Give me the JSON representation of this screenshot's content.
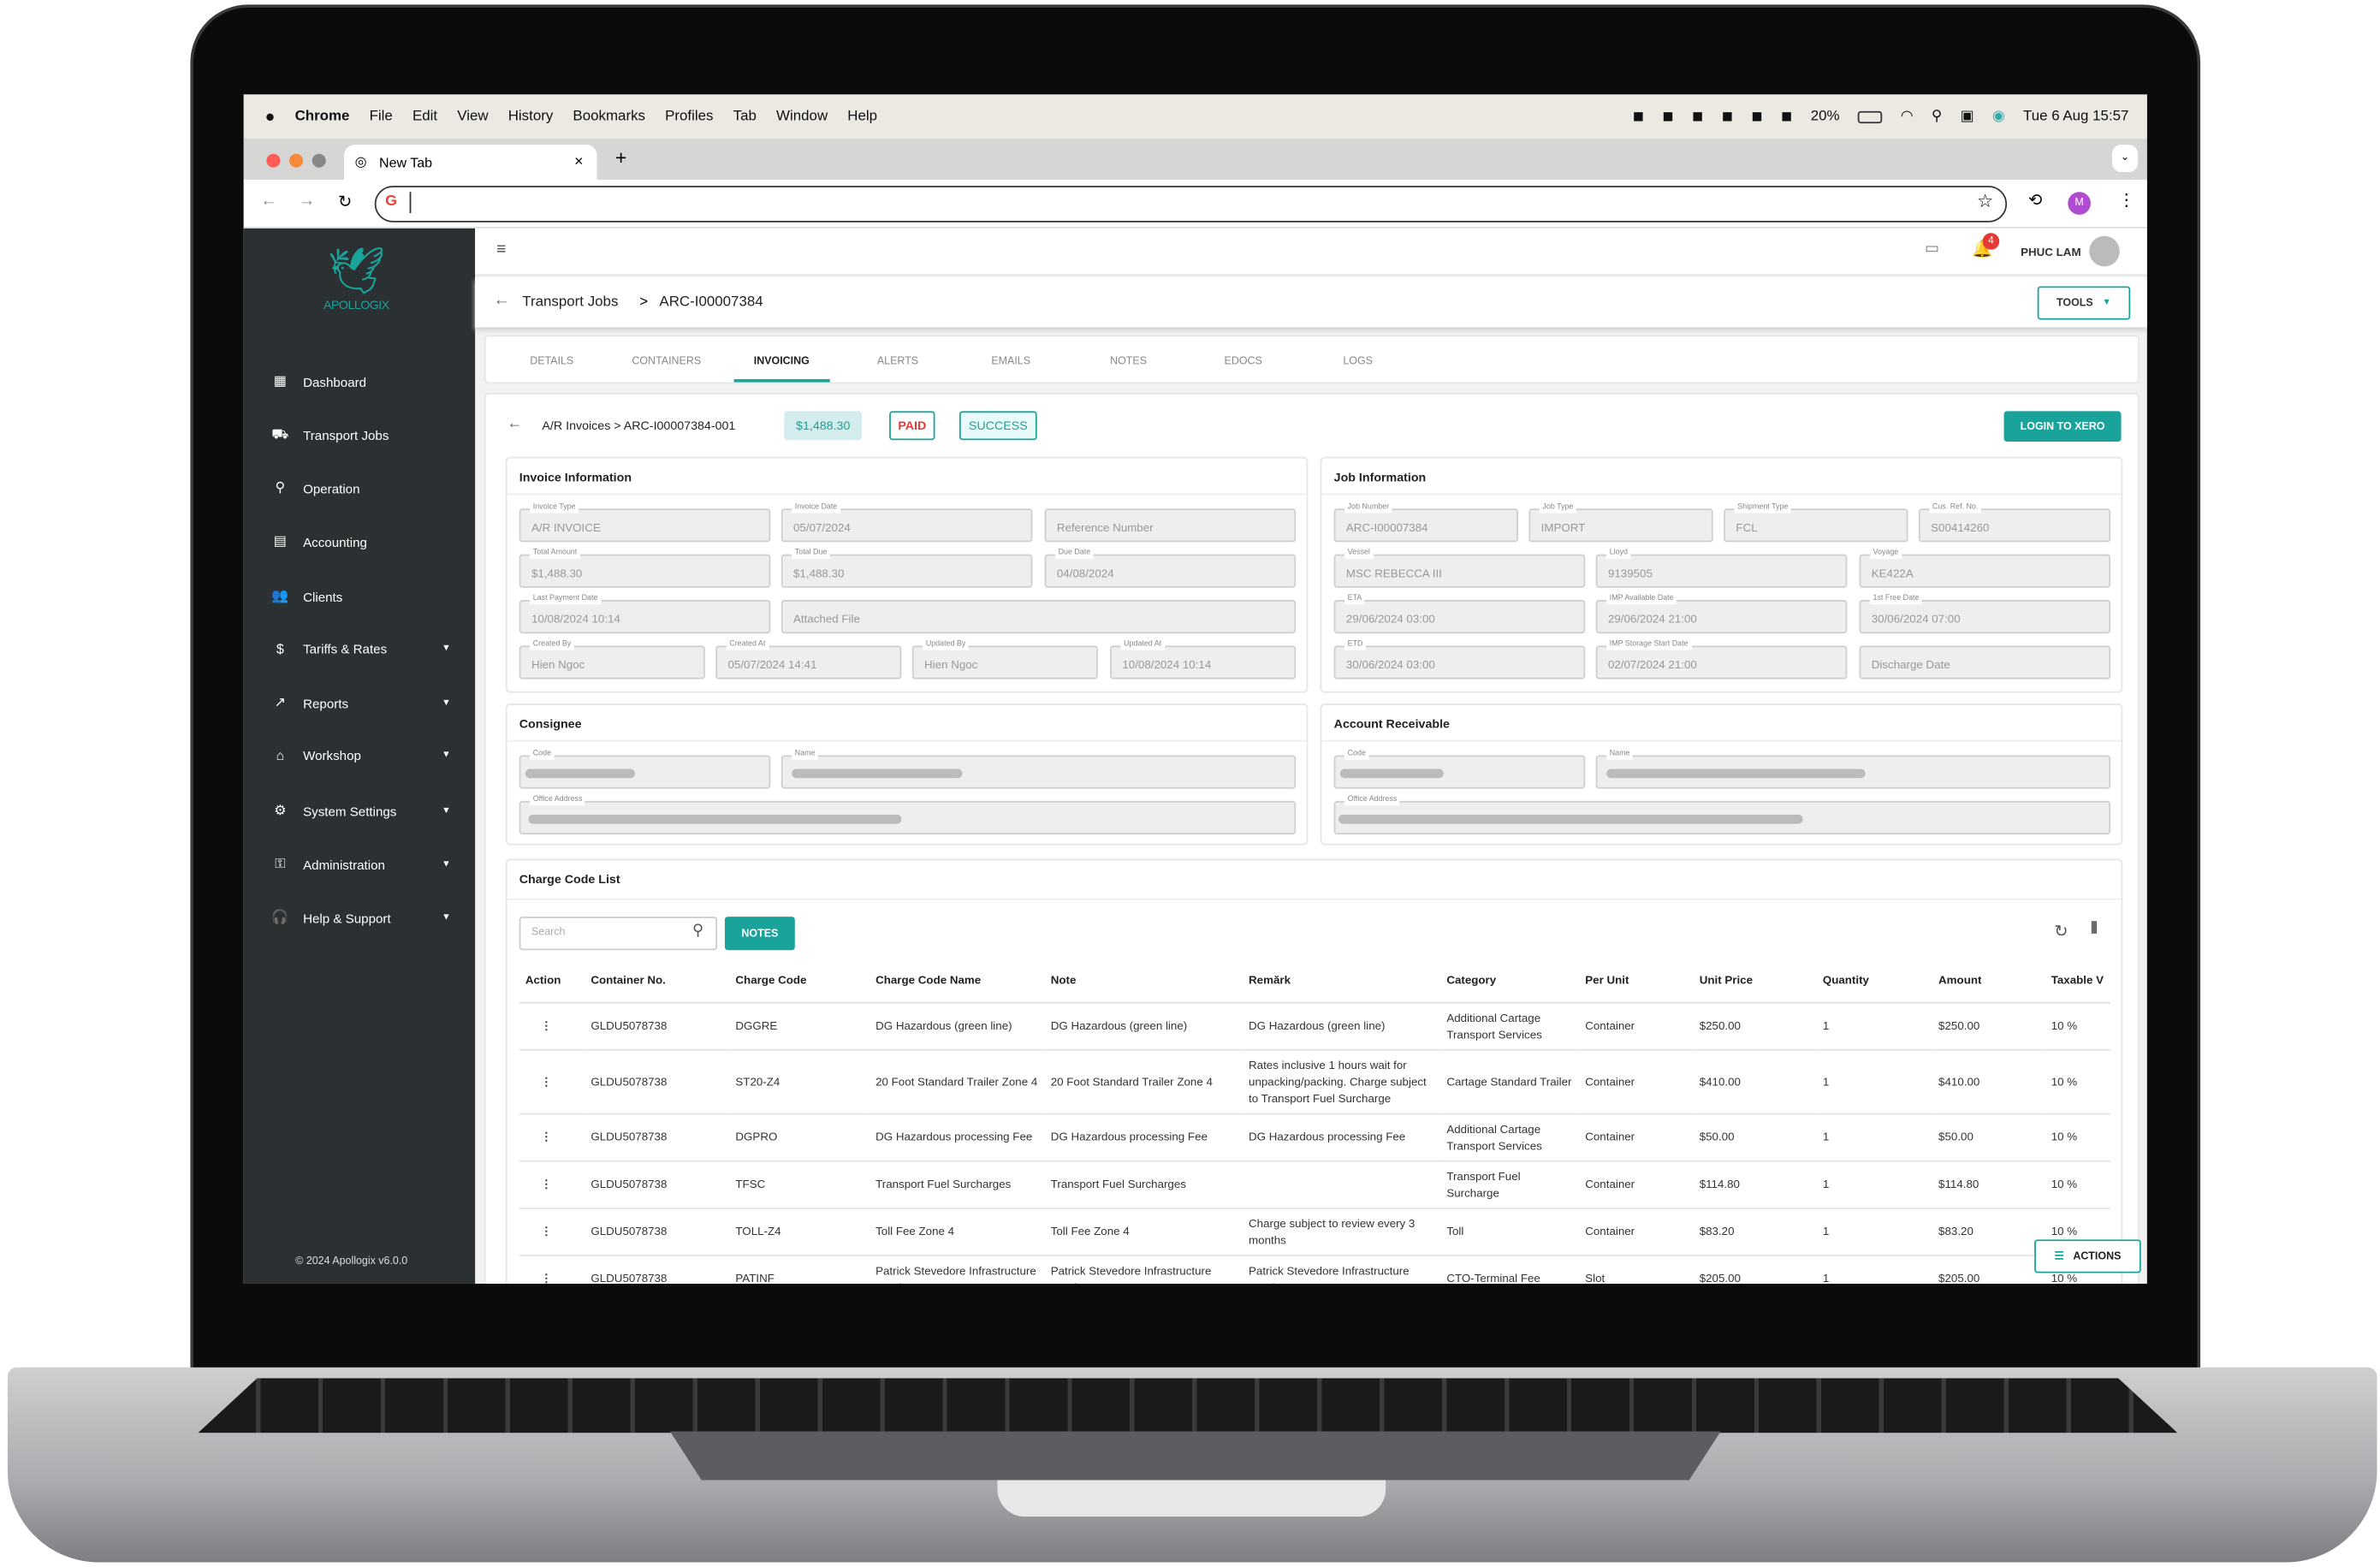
{
  "menubar": {
    "apple": "",
    "app": "Chrome",
    "items": [
      "File",
      "Edit",
      "View",
      "History",
      "Bookmarks",
      "Profiles",
      "Tab",
      "Window",
      "Help"
    ],
    "battery": "20%",
    "datetime": "Tue 6 Aug  15:57",
    "status_icons": [
      "vpn-icon",
      "teamviewer-icon",
      "network-icon",
      "chat-icon",
      "grammarly-icon",
      "check-icon"
    ]
  },
  "browser": {
    "tab_title": "New Tab",
    "new_tab": "+",
    "close": "×",
    "address": "",
    "profile_initial": "M",
    "colors": {
      "profile": "#b04ccf"
    }
  },
  "app": {
    "brand": "APOLLOGIX",
    "footer": "© 2024 Apollogix v6.0.0",
    "user": "PHUC LAM",
    "notifications": "4",
    "colors": {
      "accent": "#1aa39a",
      "sidebar": "#2b3033",
      "badge": "#e53935",
      "paid": "#e53935"
    }
  },
  "sidebar": {
    "items": [
      {
        "label": "Dashboard",
        "icon": "▦",
        "caret": false
      },
      {
        "label": "Transport Jobs",
        "icon": "⛟",
        "caret": false
      },
      {
        "label": "Operation",
        "icon": "⚲",
        "caret": false
      },
      {
        "label": "Accounting",
        "icon": "▤",
        "caret": false
      },
      {
        "label": "Clients",
        "icon": "👥",
        "caret": false
      },
      {
        "label": "Tariffs & Rates",
        "icon": "$",
        "caret": true
      },
      {
        "label": "Reports",
        "icon": "↗",
        "caret": true
      },
      {
        "label": "Workshop",
        "icon": "⌂",
        "caret": true
      },
      {
        "label": "System Settings",
        "icon": "⚙",
        "caret": true
      },
      {
        "label": "Administration",
        "icon": "⚿",
        "caret": true
      },
      {
        "label": "Help & Support",
        "icon": "🎧",
        "caret": true
      }
    ]
  },
  "breadcrumb": {
    "parent": "Transport Jobs",
    "sep": ">",
    "current": "ARC-I00007384",
    "tools": "TOOLS"
  },
  "tabs": [
    "DETAILS",
    "CONTAINERS",
    "INVOICING",
    "ALERTS",
    "EMAILS",
    "NOTES",
    "EDOCS",
    "LOGS"
  ],
  "active_tab": "INVOICING",
  "invoice_header": {
    "crumb": "A/R Invoices > ARC-I00007384-001",
    "amount": "$1,488.30",
    "paid": "PAID",
    "status": "SUCCESS",
    "xero": "LOGIN TO XERO"
  },
  "invoice_info": {
    "title": "Invoice Information",
    "fields": [
      {
        "label": "Invoice Type",
        "value": "A/R INVOICE"
      },
      {
        "label": "Invoice Date",
        "value": "05/07/2024"
      },
      {
        "label": "",
        "value": "Reference Number"
      },
      {
        "label": "Total Amount",
        "value": "$1,488.30"
      },
      {
        "label": "Total Due",
        "value": "$1,488.30"
      },
      {
        "label": "Due Date",
        "value": "04/08/2024"
      },
      {
        "label": "Last Payment Date",
        "value": "10/08/2024 10:14"
      },
      {
        "label": "",
        "value": "Attached File"
      },
      {
        "label": "Created By",
        "value": "Hien Ngoc"
      },
      {
        "label": "Created At",
        "value": "05/07/2024 14:41"
      },
      {
        "label": "Updated By",
        "value": "Hien Ngoc"
      },
      {
        "label": "Updated At",
        "value": "10/08/2024 10:14"
      }
    ]
  },
  "job_info": {
    "title": "Job Information",
    "fields": [
      {
        "label": "Job Number",
        "value": "ARC-I00007384"
      },
      {
        "label": "Job Type",
        "value": "IMPORT"
      },
      {
        "label": "Shipment Type",
        "value": "FCL"
      },
      {
        "label": "Cus. Ref. No.",
        "value": "S00414260"
      },
      {
        "label": "Vessel",
        "value": "MSC REBECCA III"
      },
      {
        "label": "Lloyd",
        "value": "9139505"
      },
      {
        "label": "Voyage",
        "value": "KE422A"
      },
      {
        "label": "ETA",
        "value": "29/06/2024 03:00"
      },
      {
        "label": "IMP Available Date",
        "value": "29/06/2024 21:00"
      },
      {
        "label": "1st Free Date",
        "value": "30/06/2024 07:00"
      },
      {
        "label": "ETD",
        "value": "30/06/2024 03:00"
      },
      {
        "label": "IMP Storage Start Date",
        "value": "02/07/2024 21:00"
      },
      {
        "label": "",
        "value": "Discharge Date"
      }
    ]
  },
  "consignee": {
    "title": "Consignee",
    "code_label": "Code",
    "name_label": "Name",
    "address_label": "Office Address"
  },
  "receivable": {
    "title": "Account Receivable",
    "code_label": "Code",
    "name_label": "Name",
    "address_label": "Office Address"
  },
  "charges": {
    "title": "Charge Code List",
    "search_placeholder": "Search",
    "notes_button": "NOTES",
    "actions_button": "ACTIONS",
    "columns": [
      "Action",
      "Container No.",
      "Charge Code",
      "Charge Code Name",
      "Note",
      "Remărk",
      "Category",
      "Per Unit",
      "Unit Price",
      "Quantity",
      "Amount",
      "Taxable V"
    ],
    "rows": [
      [
        "⋮",
        "GLDU5078738",
        "DGGRE",
        "DG Hazardous (green line)",
        "DG Hazardous (green line)",
        "DG Hazardous (green line)",
        "Additional Cartage Transport Services",
        "Container",
        "$250.00",
        "1",
        "$250.00",
        "10 %"
      ],
      [
        "⋮",
        "GLDU5078738",
        "ST20-Z4",
        "20 Foot Standard Trailer Zone 4",
        "20 Foot Standard Trailer Zone 4",
        "Rates inclusive 1 hours wait for unpacking/packing. Charge subject to Transport Fuel Surcharge",
        "Cartage Standard Trailer",
        "Container",
        "$410.00",
        "1",
        "$410.00",
        "10 %"
      ],
      [
        "⋮",
        "GLDU5078738",
        "DGPRO",
        "DG Hazardous processing Fee",
        "DG Hazardous processing Fee",
        "DG Hazardous processing Fee",
        "Additional Cartage Transport Services",
        "Container",
        "$50.00",
        "1",
        "$50.00",
        "10 %"
      ],
      [
        "⋮",
        "GLDU5078738",
        "TFSC",
        "Transport Fuel Surcharges",
        "Transport Fuel Surcharges",
        "",
        "Transport Fuel Surcharge",
        "Container",
        "$114.80",
        "1",
        "$114.80",
        "10 %"
      ],
      [
        "⋮",
        "GLDU5078738",
        "TOLL-Z4",
        "Toll Fee Zone 4",
        "Toll Fee Zone 4",
        "Charge subject to review every 3 months",
        "Toll",
        "Container",
        "$83.20",
        "1",
        "$83.20",
        "10 %"
      ],
      [
        "⋮",
        "GLDU5078738",
        "PATINF",
        "Patrick Stevedore Infrastructure Surcharge",
        "Patrick Stevedore Infrastructure Surcharge",
        "Patrick Stevedore Infrastructure Surcharge",
        "CTO-Terminal Fee",
        "Slot",
        "$205.00",
        "1",
        "$205.00",
        "10 %"
      ]
    ]
  }
}
